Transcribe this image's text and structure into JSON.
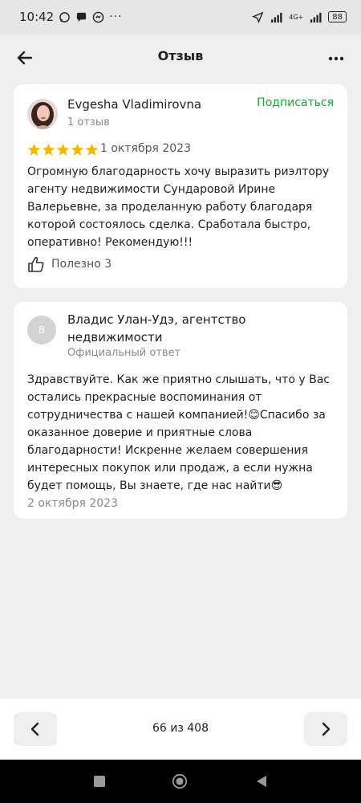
{
  "status_bar": {
    "time": "10:42",
    "signal_label": "4G+",
    "battery": "88",
    "icons": [
      "whatsapp-icon",
      "chat-bubble-icon",
      "messenger-icon",
      "more-dots-icon",
      "location-arrow-icon",
      "signal-icon",
      "signal-icon",
      "battery-icon"
    ]
  },
  "header": {
    "title": "Отзыв",
    "back_icon": "arrow-left-icon",
    "more_icon": "more-horizontal-icon"
  },
  "review": {
    "author": "Evgesha Vladimirovna",
    "author_meta": "1 отзыв",
    "subscribe_label": "Подписаться",
    "rating": 5,
    "date": "1 октября 2023",
    "text": "Огромную благодарность хочу выразить риэлтору агенту недвижимости Сундаровой Ирине Валерьевне, за проделанную работу благодаря которой состоялось сделка. Сработала быстро, оперативно! Рекомендую!!!",
    "useful_label": "Полезно 3"
  },
  "reply": {
    "avatar_letter": "В",
    "author": "Владис Улан-Удэ, агентство недвижимости",
    "meta": "Официальный ответ",
    "text": "Здравствуйте. Как же приятно слышать, что у Вас остались прекрасные воспоминания от сотрудничества с нашей компанией!😊Спасибо за оказанное доверие и приятные слова благодарности! Искренне желаем совершения интересных покупок или продаж, а если нужна будет помощь, Вы знаете, где нас найти😎",
    "date": "2 октября 2023"
  },
  "pagination": {
    "label": "66 из 408",
    "prev_icon": "chevron-left-icon",
    "next_icon": "chevron-right-icon"
  },
  "colors": {
    "accent_green": "#1aa33a",
    "star_gold": "#f5b800",
    "background": "#efefef",
    "card": "#ffffff"
  }
}
